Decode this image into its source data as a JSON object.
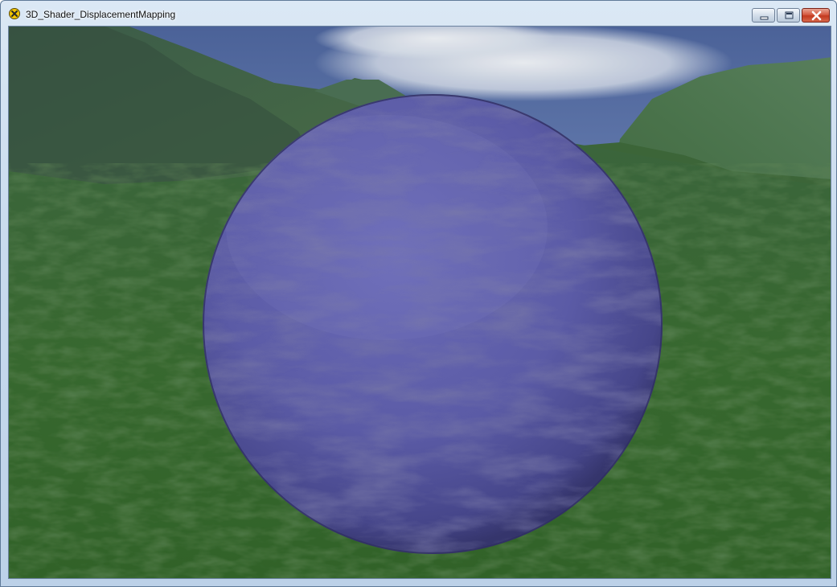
{
  "window": {
    "title": "3D_Shader_DisplacementMapping",
    "icon": "app-icon-yellow-x",
    "controls": {
      "minimize": "minimize-icon",
      "maximize": "maximize-icon",
      "close": "close-icon"
    }
  },
  "scene": {
    "sky_color": "#6e86c0",
    "cloud_color": "#dfe6f0",
    "terrain_color": "#3f6f34",
    "mountain_color": "#476b47",
    "sphere_color": "#5a5aa2"
  }
}
